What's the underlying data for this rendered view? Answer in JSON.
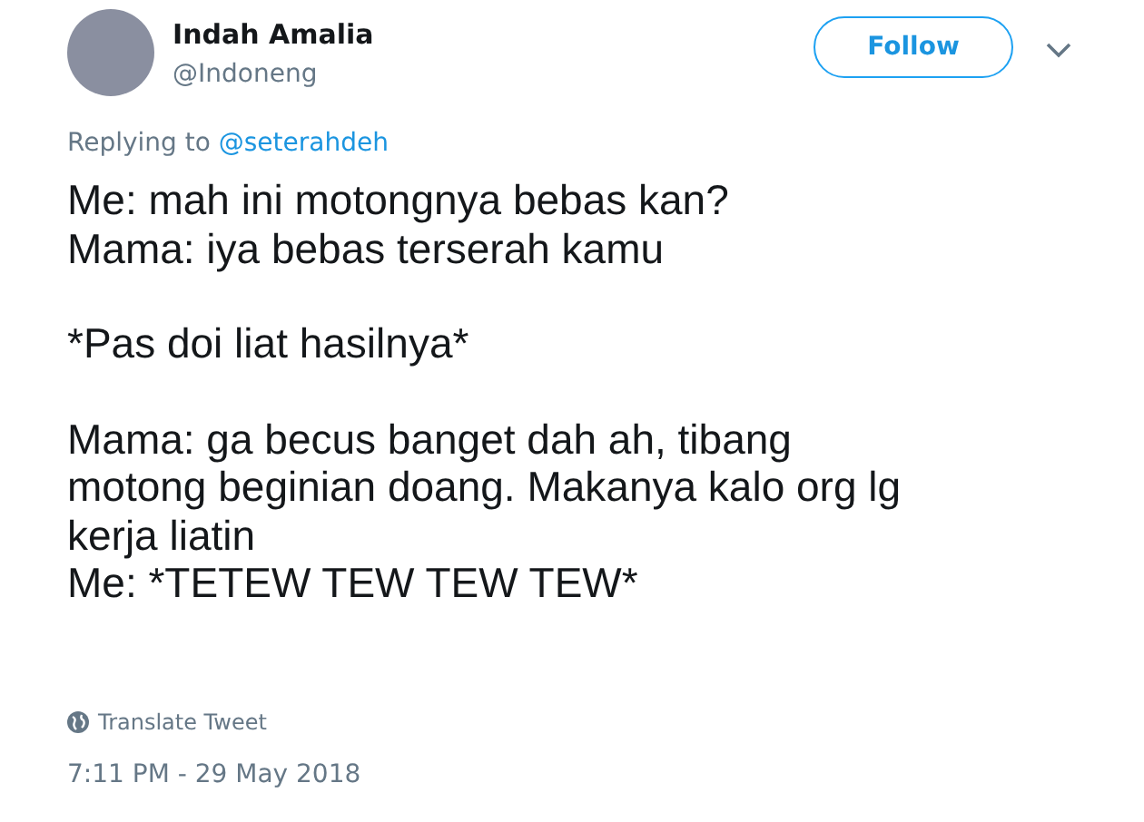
{
  "author": {
    "name": "Indah Amalia",
    "handle": "@Indoneng"
  },
  "follow_button": {
    "label": "Follow"
  },
  "reply_context": {
    "prefix": "Replying to",
    "mention": "@seterahdeh"
  },
  "tweet_paragraphs": [
    "Me: mah ini motongnya bebas kan?\nMama: iya bebas terserah kamu",
    "*Pas doi liat hasilnya*",
    "Mama: ga becus banget dah ah, tibang\nmotong beginian doang. Makanya kalo org lg\nkerja liatin\nMe: *TETEW TEW TEW TEW*"
  ],
  "translate_link": "Translate Tweet",
  "timestamp": "7:11 PM - 29 May 2018"
}
